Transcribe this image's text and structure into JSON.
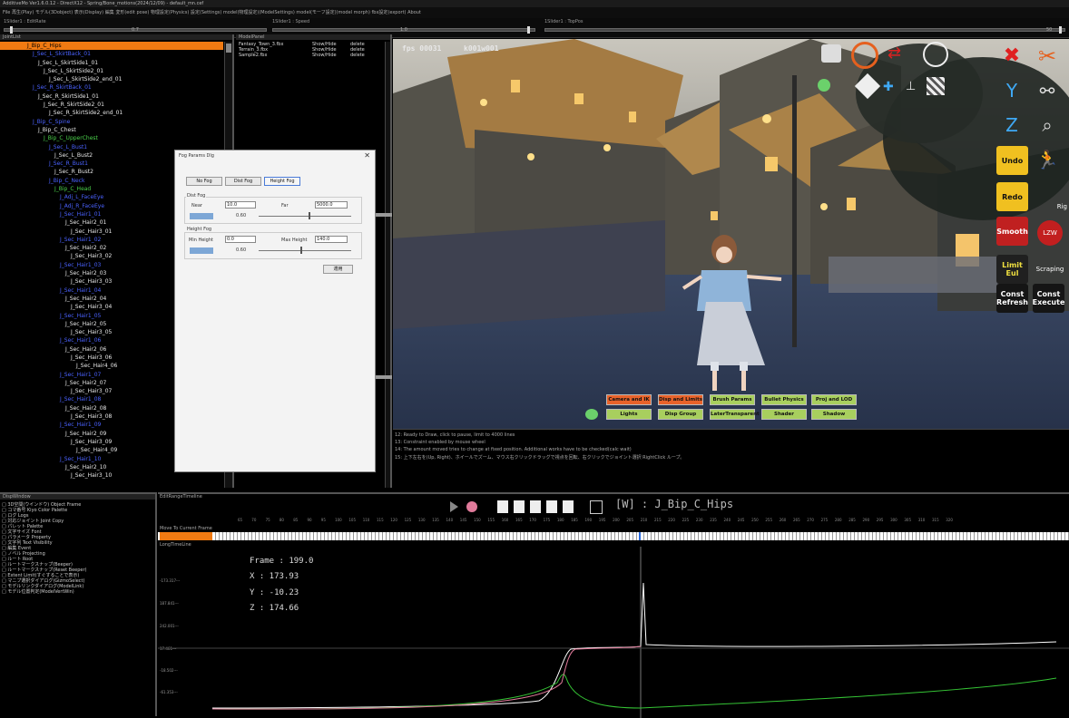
{
  "window": {
    "title": "AdditiveMo Ver1.6.0.12 - DirectX12 - Spring/Bone_motions(2024/12/09) - default_mn.cef",
    "menu": "File   再生(Play)   モデル(3Dobject)   表示(Display)   編集  変形(edit pose)   物理設定(Physics)   設定(Settings)   model(物理設定)(ModelSettings)   model(モーフ設定)(model morph)   fbx設定(export)   About"
  },
  "toolbar": {
    "label1": "1Slider1 : EditRate",
    "label2": "1Slider1 : Speed",
    "label3": "1Slider1 : TopPos",
    "val1": "0.7",
    "val2": "1.0",
    "val3": "50"
  },
  "joint_panel": {
    "title": "JointList",
    "rows": [
      {
        "text": "J_Bip_C_Hips",
        "indent": 5,
        "style": "sel"
      },
      {
        "text": "J_Sec_L_SkirtBack_01",
        "indent": 6,
        "style": "blue"
      },
      {
        "text": "J_Sec_L_SkirtSide1_01",
        "indent": 7,
        "style": "white"
      },
      {
        "text": "J_Sec_L_SkirtSide2_01",
        "indent": 8,
        "style": "white"
      },
      {
        "text": "J_Sec_L_SkirtSide2_end_01",
        "indent": 9,
        "style": "white"
      },
      {
        "text": "J_Sec_R_SkirtBack_01",
        "indent": 6,
        "style": "blue"
      },
      {
        "text": "J_Sec_R_SkirtSide1_01",
        "indent": 7,
        "style": "white"
      },
      {
        "text": "J_Sec_R_SkirtSide2_01",
        "indent": 8,
        "style": "white"
      },
      {
        "text": "J_Sec_R_SkirtSide2_end_01",
        "indent": 9,
        "style": "white"
      },
      {
        "text": "J_Bip_C_Spine",
        "indent": 6,
        "style": "blue"
      },
      {
        "text": "J_Bip_C_Chest",
        "indent": 7,
        "style": "white"
      },
      {
        "text": "J_Bip_C_UpperChest",
        "indent": 8,
        "style": "green"
      },
      {
        "text": "J_Sec_L_Bust1",
        "indent": 9,
        "style": "blue"
      },
      {
        "text": "J_Sec_L_Bust2",
        "indent": 10,
        "style": "white"
      },
      {
        "text": "J_Sec_R_Bust1",
        "indent": 9,
        "style": "blue"
      },
      {
        "text": "J_Sec_R_Bust2",
        "indent": 10,
        "style": "white"
      },
      {
        "text": "J_Bip_C_Neck",
        "indent": 9,
        "style": "blue"
      },
      {
        "text": "J_Bip_C_Head",
        "indent": 10,
        "style": "green"
      },
      {
        "text": "J_Adj_L_FaceEye",
        "indent": 11,
        "style": "blue"
      },
      {
        "text": "J_Adj_R_FaceEye",
        "indent": 11,
        "style": "blue"
      },
      {
        "text": "J_Sec_Hair1_01",
        "indent": 11,
        "style": "blue"
      },
      {
        "text": "J_Sec_Hair2_01",
        "indent": 12,
        "style": "white"
      },
      {
        "text": "J_Sec_Hair3_01",
        "indent": 13,
        "style": "white"
      },
      {
        "text": "J_Sec_Hair1_02",
        "indent": 11,
        "style": "blue"
      },
      {
        "text": "J_Sec_Hair2_02",
        "indent": 12,
        "style": "white"
      },
      {
        "text": "J_Sec_Hair3_02",
        "indent": 13,
        "style": "white"
      },
      {
        "text": "J_Sec_Hair1_03",
        "indent": 11,
        "style": "blue"
      },
      {
        "text": "J_Sec_Hair2_03",
        "indent": 12,
        "style": "white"
      },
      {
        "text": "J_Sec_Hair3_03",
        "indent": 13,
        "style": "white"
      },
      {
        "text": "J_Sec_Hair1_04",
        "indent": 11,
        "style": "blue"
      },
      {
        "text": "J_Sec_Hair2_04",
        "indent": 12,
        "style": "white"
      },
      {
        "text": "J_Sec_Hair3_04",
        "indent": 13,
        "style": "white"
      },
      {
        "text": "J_Sec_Hair1_05",
        "indent": 11,
        "style": "blue"
      },
      {
        "text": "J_Sec_Hair2_05",
        "indent": 12,
        "style": "white"
      },
      {
        "text": "J_Sec_Hair3_05",
        "indent": 13,
        "style": "white"
      },
      {
        "text": "J_Sec_Hair1_06",
        "indent": 11,
        "style": "blue"
      },
      {
        "text": "J_Sec_Hair2_06",
        "indent": 12,
        "style": "white"
      },
      {
        "text": "J_Sec_Hair3_06",
        "indent": 13,
        "style": "white"
      },
      {
        "text": "J_Sec_Hair4_06",
        "indent": 14,
        "style": "white"
      },
      {
        "text": "J_Sec_Hair1_07",
        "indent": 11,
        "style": "blue"
      },
      {
        "text": "J_Sec_Hair2_07",
        "indent": 12,
        "style": "white"
      },
      {
        "text": "J_Sec_Hair3_07",
        "indent": 13,
        "style": "white"
      },
      {
        "text": "J_Sec_Hair1_08",
        "indent": 11,
        "style": "blue"
      },
      {
        "text": "J_Sec_Hair2_08",
        "indent": 12,
        "style": "white"
      },
      {
        "text": "J_Sec_Hair3_08",
        "indent": 13,
        "style": "white"
      },
      {
        "text": "J_Sec_Hair1_09",
        "indent": 11,
        "style": "blue"
      },
      {
        "text": "J_Sec_Hair2_09",
        "indent": 12,
        "style": "white"
      },
      {
        "text": "J_Sec_Hair3_09",
        "indent": 13,
        "style": "white"
      },
      {
        "text": "J_Sec_Hair4_09",
        "indent": 14,
        "style": "white"
      },
      {
        "text": "J_Sec_Hair1_10",
        "indent": 11,
        "style": "blue"
      },
      {
        "text": "J_Sec_Hair2_10",
        "indent": 12,
        "style": "white"
      },
      {
        "text": "J_Sec_Hair3_10",
        "indent": 13,
        "style": "white"
      }
    ]
  },
  "model_panel": {
    "title": "ModelPanel",
    "rows": [
      {
        "name": "Fantasy_Town_3.fbx",
        "show": "Show/Hide",
        "del": "delete",
        "active": false
      },
      {
        "name": "Terrain_3.fbx",
        "show": "Show/Hide",
        "del": "delete",
        "active": false
      },
      {
        "name": "Sample2.fbx",
        "show": "Show/Hide",
        "del": "delete",
        "active": true
      }
    ]
  },
  "viewport": {
    "fps": "fps 00031",
    "counter": "k001w001",
    "right_buttons": [
      {
        "label": "Undo",
        "bg": "#f0c020",
        "fg": "#111"
      },
      {
        "label": "Redo",
        "bg": "#f0c020",
        "fg": "#111"
      },
      {
        "label": "Smooth",
        "bg": "#c02020",
        "fg": "#fff"
      },
      {
        "label": "Limit Eul",
        "bg": "#202020",
        "fg": "#f0e040"
      },
      {
        "label": "Const Refresh",
        "bg": "#151515",
        "fg": "#fff"
      },
      {
        "label": "Const Execute",
        "bg": "#151515",
        "fg": "#fff"
      }
    ],
    "side_labels": [
      "Rig",
      "LZW",
      "Scraping"
    ],
    "bottom_buttons_row1": [
      {
        "label": "Camera and IK",
        "kind": "or"
      },
      {
        "label": "Disp and Limits",
        "kind": "or"
      },
      {
        "label": "Brush Params",
        "kind": "gr"
      },
      {
        "label": "Bullet Physics",
        "kind": "gr"
      },
      {
        "label": "Proj and LOD",
        "kind": "gr"
      }
    ],
    "bottom_buttons_row2": [
      {
        "label": "Lights",
        "kind": "gr"
      },
      {
        "label": "Disp Group",
        "kind": "gr"
      },
      {
        "label": "LaterTransparent",
        "kind": "gr"
      },
      {
        "label": "Shader",
        "kind": "gr"
      },
      {
        "label": "Shadow",
        "kind": "gr"
      }
    ]
  },
  "fog_dialog": {
    "title": "Fog Params Dlg",
    "close": "✕",
    "btn_nofog": "No Fog",
    "btn_distfog": "Dist Fog",
    "btn_heightfog": "Height Fog",
    "dist_group": "Dist Fog",
    "near_label": "Near",
    "near_value": "10.0",
    "far_label": "Far",
    "far_value": "5000.0",
    "dist_slider_value": "0.60",
    "height_group": "Height Fog",
    "minh_label": "Min Height",
    "minh_value": "0.0",
    "maxh_label": "Max Height",
    "maxh_value": "140.0",
    "height_slider_value": "0.60",
    "ok_label": "適用"
  },
  "log": {
    "lines": [
      "12: Ready to Draw, click to pause, limit to 4000 lines",
      "13: Constraint enabled by mouse wheel",
      "14: The amount moved tries to change at fixed position. Additional works have to be checked(calc wait)",
      "15: 上下左右を(Up, Right)、ホイールでズーム、マウス右クリックドラッグで視点を回転、右クリックでジョイント選択 RightClick ループ。"
    ]
  },
  "disp_panel": {
    "title": "DispWindow",
    "rows": [
      "□ 3D空間(ウインドウ) Object Frame",
      "□ コマ番号 Kiyo Color Palette",
      "□ ログ Logs",
      "□ 対応ジョイント Joint Copy",
      "□ パレット Palette",
      "□ 文字サイズ Font",
      "□ パラメータ Property",
      "□ 文字列 Text Visibility",
      "□ 編集 Event",
      "□ ノベル Projecting",
      "□ ルート Root",
      "□ ルートマークスナップ(Beeper)",
      "□ ルートマークスナップ(Reset Beeper)",
      "□ Extent Limit(すぐすることで表示)",
      "□ マニプ選択ダイアログ(GizmoSelect)",
      "□ モデルリンクダイアログ(ModelLink)",
      "□ モデル位置判定(ModelVertWin)"
    ]
  },
  "timeline": {
    "title": "EditRangeTimeline",
    "joint": "[W] : J_Bip_C_Hips",
    "move_label": "Move To Current Frame",
    "long_label": "LongTimeLine",
    "frame_ticks": [
      "65",
      "70",
      "75",
      "80",
      "85",
      "90",
      "95",
      "100",
      "105",
      "110",
      "115",
      "120",
      "125",
      "130",
      "135",
      "140",
      "145",
      "150",
      "155",
      "160",
      "165",
      "170",
      "175",
      "180",
      "185",
      "190",
      "195",
      "200",
      "205",
      "210",
      "215",
      "220",
      "225",
      "230",
      "235",
      "240",
      "245",
      "250",
      "255",
      "260",
      "265",
      "270",
      "275",
      "280",
      "285",
      "290",
      "295",
      "300",
      "305",
      "310",
      "315",
      "320"
    ],
    "readout": {
      "frame": "Frame : 199.0",
      "x": "X : 173.93",
      "y": "Y : -10.23",
      "z": "Z : 174.66"
    },
    "y_labels": [
      "-173.317---",
      "187.841---",
      "242.001---",
      "17.461---",
      "-18.502---",
      "-61.353---"
    ],
    "curve_frames_note": "",
    "colors": {
      "accent": "#f07a12",
      "curve_white": "#ffffff",
      "curve_green": "#35c435",
      "curve_pink": "#e07a9a"
    }
  }
}
